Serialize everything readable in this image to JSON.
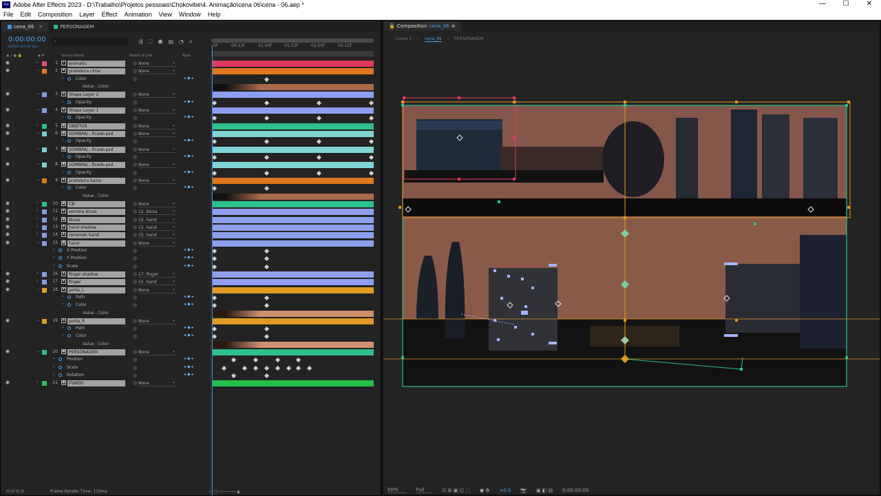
{
  "window": {
    "title": "Adobe After Effects 2023 - D:\\Trabalho\\Projetos pessoais\\Chokovibe\\4. Animação\\cena 06\\cena - 06.aep *",
    "app_icon": "Ae",
    "controls": [
      "—",
      "☐",
      "✕"
    ]
  },
  "menu": [
    "File",
    "Edit",
    "Composition",
    "Layer",
    "Effect",
    "Animation",
    "View",
    "Window",
    "Help"
  ],
  "timeline": {
    "tabs": [
      {
        "label": "cena_06",
        "color": "#3a9ad9",
        "active": true
      },
      {
        "label": "PERSONAGEM",
        "color": "#2fbd8a",
        "active": false
      }
    ],
    "timecode": "0:00:00:00",
    "fps": "00000 (24.00 fps)",
    "search_placeholder": "",
    "columns": {
      "source": "Source Name",
      "parent": "Parent & Link",
      "keys": "Keys"
    },
    "ruler_ticks": [
      "0f",
      "00:12f",
      "01:00f",
      "01:12f",
      "02:00f",
      "02:12f"
    ],
    "footer": "Frame Render Time: 110ms",
    "layers": [
      {
        "kind": "layer",
        "num": "1",
        "name": "animatic",
        "color": "#e0506a",
        "type": "F",
        "parent": "None",
        "bar": "#e03a5e",
        "eye": true
      },
      {
        "kind": "layer",
        "num": "2",
        "name": "prateleira cima",
        "color": "#e07a20",
        "type": "★",
        "parent": "None",
        "bar": "#e0781e",
        "eye": true,
        "open": true
      },
      {
        "kind": "prop",
        "name": "Color",
        "indent": 1,
        "kfs": [
          0.33
        ],
        "nav": true
      },
      {
        "kind": "value",
        "name": "Value : Color",
        "grad": [
          "#111111",
          "#a86a4a"
        ]
      },
      {
        "kind": "layer",
        "num": "3",
        "name": "Shape Layer 2",
        "color": "#8a9ae0",
        "type": "★",
        "parent": "None",
        "bar": "#8f9ff0",
        "eye": true,
        "open": true
      },
      {
        "kind": "prop",
        "name": "Opacity",
        "indent": 1,
        "kfs": [
          0,
          0.33,
          0.66,
          0.99
        ],
        "nav": true
      },
      {
        "kind": "layer",
        "num": "4",
        "name": "Shape Layer 1",
        "color": "#8a9ae0",
        "type": "★",
        "parent": "None",
        "bar": "#8f9ff0",
        "eye": true,
        "open": true
      },
      {
        "kind": "prop",
        "name": "Opacity",
        "indent": 1,
        "kfs": [
          0,
          0.33,
          0.66,
          0.99
        ],
        "nav": true
      },
      {
        "kind": "layer",
        "num": "5",
        "name": "OBJETOS",
        "color": "#28c08a",
        "type": "▣",
        "parent": "None",
        "bar": "#2ec08c",
        "eye": true
      },
      {
        "kind": "layer",
        "num": "6",
        "name": "SOMBRA/...ficado.psd",
        "color": "#7ad0d0",
        "type": "▣",
        "parent": "None",
        "bar": "#80d4d4",
        "eye": true,
        "open": true
      },
      {
        "kind": "prop",
        "name": "Opacity",
        "indent": 1,
        "kfs": [
          0,
          0.33,
          0.66,
          0.99
        ],
        "nav": true
      },
      {
        "kind": "layer",
        "num": "7",
        "name": "SOMBRA/...ficado.psd",
        "color": "#7ad0d0",
        "type": "▣",
        "parent": "None",
        "bar": "#80d4d4",
        "eye": true,
        "open": true
      },
      {
        "kind": "prop",
        "name": "Opacity",
        "indent": 1,
        "kfs": [
          0,
          0.33,
          0.66,
          0.99
        ],
        "nav": true
      },
      {
        "kind": "layer",
        "num": "8",
        "name": "SOMBRA/...ficado.psd",
        "color": "#7ad0d0",
        "type": "▣",
        "parent": "None",
        "bar": "#80d4d4",
        "eye": true,
        "open": true
      },
      {
        "kind": "prop",
        "name": "Opacity",
        "indent": 1,
        "kfs": [
          0,
          0.33,
          0.66,
          0.99
        ],
        "nav": true
      },
      {
        "kind": "layer",
        "num": "9",
        "name": "prateleira baixo",
        "color": "#e07a20",
        "type": "★",
        "parent": "None",
        "bar": "#e0781e",
        "eye": true,
        "open": true
      },
      {
        "kind": "prop",
        "name": "Color",
        "indent": 1,
        "kfs": [
          0,
          0.33
        ],
        "nav": true
      },
      {
        "kind": "value",
        "name": "Value : Color",
        "grad": [
          "#111111",
          "#a86a4a"
        ]
      },
      {
        "kind": "layer",
        "num": "10",
        "name": "CB",
        "color": "#28c08a",
        "type": "▣",
        "parent": "None",
        "bar": "#2ec08c",
        "eye": true
      },
      {
        "kind": "layer",
        "num": "11",
        "name": "sombra blusa",
        "color": "#8a9ae0",
        "type": "★",
        "parent": "12. blusa",
        "bar": "#8f9ff0",
        "eye": true
      },
      {
        "kind": "layer",
        "num": "12",
        "name": "blusa",
        "color": "#8a9ae0",
        "type": "▣",
        "parent": "15. hand",
        "bar": "#8f9ff0",
        "eye": true
      },
      {
        "kind": "layer",
        "num": "13",
        "name": "hand shadow",
        "color": "#8a9ae0",
        "type": "★",
        "parent": "15. hand",
        "bar": "#8f9ff0",
        "eye": true
      },
      {
        "kind": "layer",
        "num": "14",
        "name": "remendo hand",
        "color": "#8a9ae0",
        "type": "★",
        "parent": "15. hand",
        "bar": "#8f9ff0",
        "eye": true
      },
      {
        "kind": "layer",
        "num": "15",
        "name": "hand",
        "color": "#8a9ae0",
        "type": "▣",
        "parent": "None",
        "bar": "#8f9ff0",
        "eye": true,
        "open": true
      },
      {
        "kind": "prop",
        "name": "X Position",
        "indent": 0,
        "kfs": [
          0,
          0.33
        ],
        "nav": true
      },
      {
        "kind": "prop",
        "name": "Y Position",
        "indent": 0,
        "kfs": [
          0,
          0.33
        ],
        "nav": true
      },
      {
        "kind": "prop",
        "name": "Scale",
        "indent": 0,
        "kfs": [
          0,
          0.33
        ],
        "nav": true
      },
      {
        "kind": "layer",
        "num": "16",
        "name": "finger shadow",
        "color": "#8a9ae0",
        "type": "★",
        "parent": "17. finger",
        "bar": "#8f9ff0",
        "eye": true
      },
      {
        "kind": "layer",
        "num": "17",
        "name": "finger",
        "color": "#8a9ae0",
        "type": "★",
        "parent": "15. hand",
        "bar": "#8f9ff0",
        "eye": true
      },
      {
        "kind": "layer",
        "num": "18",
        "name": "porta_L",
        "color": "#e0a020",
        "type": "★",
        "parent": "None",
        "bar": "#e09a22",
        "eye": true,
        "open": true
      },
      {
        "kind": "prop",
        "name": "Path",
        "indent": 1,
        "kfs": [
          0,
          0.33
        ],
        "nav": true
      },
      {
        "kind": "prop",
        "name": "Color",
        "indent": 1,
        "kfs": [
          0,
          0.33
        ],
        "nav": true
      },
      {
        "kind": "value",
        "name": "Value : Color",
        "grad": [
          "#2a1a10",
          "#d09070"
        ]
      },
      {
        "kind": "layer",
        "num": "19",
        "name": "porta_R",
        "color": "#e0a020",
        "type": "★",
        "parent": "None",
        "bar": "#e09a22",
        "eye": true,
        "open": true
      },
      {
        "kind": "prop",
        "name": "Path",
        "indent": 1,
        "kfs": [
          0,
          0.33
        ],
        "nav": true
      },
      {
        "kind": "prop",
        "name": "Color",
        "indent": 1,
        "kfs": [
          0,
          0.33
        ],
        "nav": true
      },
      {
        "kind": "value",
        "name": "Value : Color",
        "grad": [
          "#2a1a10",
          "#d09070"
        ]
      },
      {
        "kind": "layer",
        "num": "20",
        "name": "PERSONAGEM",
        "color": "#28c08a",
        "type": "▣",
        "parent": "None",
        "bar": "#2ec08c",
        "eye": true,
        "open": true
      },
      {
        "kind": "prop",
        "name": "Position",
        "indent": 0,
        "kfs": [
          0.12,
          0.26,
          0.4,
          0.53
        ],
        "nav": true
      },
      {
        "kind": "prop",
        "name": "Scale",
        "indent": 0,
        "kfs": [
          0.06,
          0.19,
          0.26,
          0.33,
          0.4,
          0.47,
          0.53,
          0.6
        ],
        "nav": true
      },
      {
        "kind": "prop",
        "name": "Rotation",
        "indent": 0,
        "kfs": [
          0.12,
          0.33
        ],
        "nav": true
      },
      {
        "kind": "layer",
        "num": "21",
        "name": "FUNDO",
        "color": "#28c060",
        "type": "▣",
        "parent": "None",
        "bar": "#22c04a",
        "eye": true
      }
    ]
  },
  "composition": {
    "tab_label": "Composition",
    "tab_comp": "cena_06",
    "breadcrumbs": [
      "Comp 1",
      "cena_06",
      "PERSONAGEM"
    ],
    "footer": {
      "zoom": "50%",
      "quality": "Full",
      "exposure": "+0.0",
      "timecode": "0:00:00:00"
    }
  }
}
